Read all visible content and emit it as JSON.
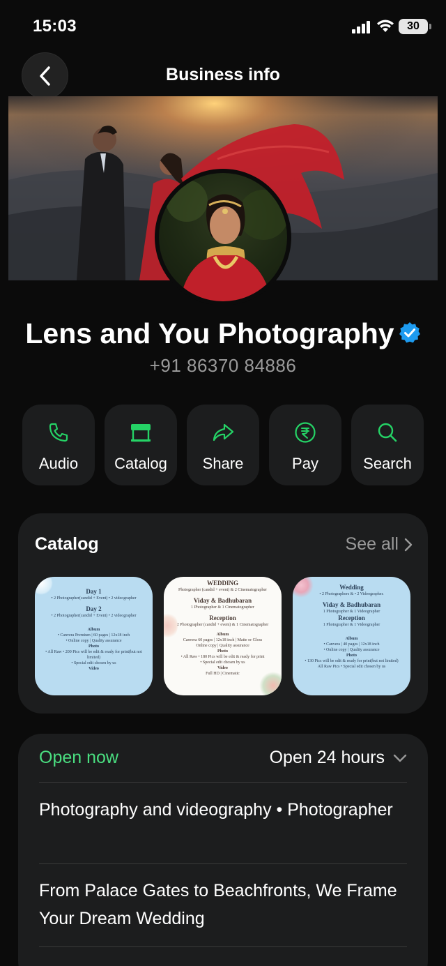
{
  "status_bar": {
    "time": "15:03",
    "battery": "30"
  },
  "header": {
    "title": "Business info"
  },
  "business": {
    "name": "Lens and You Photography",
    "phone": "+91 86370 84886"
  },
  "actions": [
    {
      "label": "Audio",
      "icon": "phone-icon"
    },
    {
      "label": "Catalog",
      "icon": "storefront-icon"
    },
    {
      "label": "Share",
      "icon": "share-arrow-icon"
    },
    {
      "label": "Pay",
      "icon": "rupee-icon"
    },
    {
      "label": "Search",
      "icon": "search-icon"
    }
  ],
  "catalog": {
    "title": "Catalog",
    "see_all": "See all",
    "items": [
      {
        "lines": [
          "Day 1",
          "• 2 Photographer(candid + Event) • 2 videographer",
          "Day 2",
          "• 2 Photographer(candid + Event) • 2 videographer",
          "Album",
          "• Canvera Premium | 60 pages | 12x18 inch",
          "• Online copy | Quality assurance",
          "Photo",
          "• All Raw • 200 Pics will be edit & ready for print(but not limited)",
          "• Special edit chosen by us",
          "Video"
        ]
      },
      {
        "lines": [
          "WEDDING",
          "Photographer (candid + event) & 2 Cinematographer",
          "Viday & Badhubaran",
          "1 Photographer & 1 Cinematographer",
          "Reception",
          "2 Photographer (candid + event) & 1 Cinematographer",
          "Album",
          "Canvera 60 pages | 12x18 inch | Matte or Gloss",
          "Online copy | Quality assurance",
          "Photo",
          "• All Raw • 180 Pics will be edit & ready for print",
          "• Special edit chosen by us",
          "Video",
          "Full HD | Cinematic"
        ]
      },
      {
        "lines": [
          "Wedding",
          "• 2 Photographers & • 2 Videographer.",
          "Viday & Badhubaran",
          "1 Photographer & 1 Videographer",
          "Reception",
          "1 Photographer & 1 Videographer",
          "Album",
          "• Canvera | 40 pages | 12x18 inch",
          "• Online copy | Quality assurance",
          "Photo",
          "• 130 Pics will be edit & ready for print(but not limited)",
          "All Raw Pics • Special edit chosen by us"
        ]
      }
    ]
  },
  "hours": {
    "status": "Open now",
    "detail": "Open 24 hours"
  },
  "category": "Photography and videography • Photographer",
  "description": "From Palace Gates to Beachfronts, We Frame Your Dream Wedding",
  "colors": {
    "accent_green": "#25d366",
    "open_green": "#4ade80",
    "verified_blue": "#1d9bf0",
    "card_bg": "#1c1d1e"
  }
}
